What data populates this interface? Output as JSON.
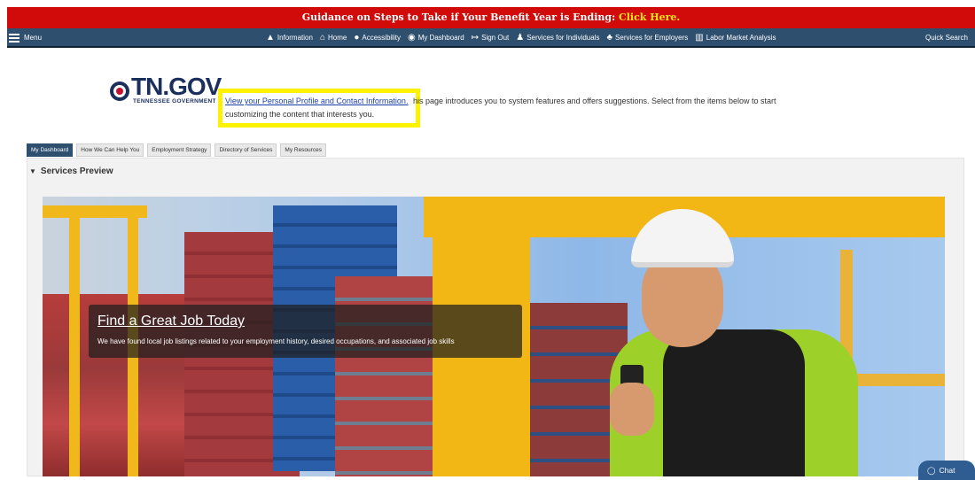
{
  "banner": {
    "text": "Guidance on Steps to Take if Your Benefit Year is Ending:",
    "link": "Click Here."
  },
  "nav": {
    "menu_label": "Menu",
    "items": [
      {
        "icon": "▲",
        "label": "Information"
      },
      {
        "icon": "⌂",
        "label": "Home"
      },
      {
        "icon": "●",
        "label": "Accessibility"
      },
      {
        "icon": "◉",
        "label": "My Dashboard"
      },
      {
        "icon": "↦",
        "label": "Sign Out"
      },
      {
        "icon": "♟",
        "label": "Services for Individuals"
      },
      {
        "icon": "♣",
        "label": "Services for Employers"
      },
      {
        "icon": "▥",
        "label": "Labor Market Analysis"
      }
    ],
    "quick_search": "Quick Search"
  },
  "logo": {
    "text": "TN.GOV",
    "sub": "TENNESSEE GOVERNMENT"
  },
  "intro": {
    "link": "View your Personal Profile and Contact Information.",
    "rest": "his page introduces you to system features and offers suggestions. Select from the items below to start",
    "line2": "customizing the content that interests you."
  },
  "tabs": [
    "My Dashboard",
    "How We Can Help You",
    "Employment Strategy",
    "Directory of Services",
    "My Resources"
  ],
  "section": {
    "title": "Services Preview"
  },
  "hero": {
    "title": "Find a Great Job Today",
    "subtitle": "We have found local job listings related to your employment history, desired occupations, and associated job skills"
  },
  "chat": {
    "label": "Chat"
  },
  "colors": {
    "banner": "#d10a0a",
    "banner_link": "#f5e51a",
    "nav": "#2e4f6e",
    "highlight": "#fff200"
  }
}
